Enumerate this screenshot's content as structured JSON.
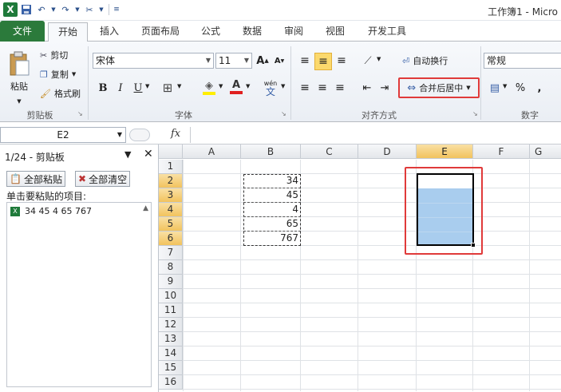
{
  "window": {
    "title": "工作簿1 - Micro"
  },
  "tabs": [
    "文件",
    "开始",
    "插入",
    "页面布局",
    "公式",
    "数据",
    "审阅",
    "视图",
    "开发工具"
  ],
  "clipboard_group": {
    "paste": "粘贴",
    "cut": "剪切",
    "copy": "复制",
    "format_painter": "格式刷",
    "label": "剪贴板"
  },
  "font_group": {
    "font_name": "宋体",
    "font_size": "11",
    "bold": "B",
    "italic": "I",
    "underline": "U",
    "phonetic": "wén",
    "label": "字体"
  },
  "align_group": {
    "wrap": "自动换行",
    "merge": "合并后居中",
    "label": "对齐方式"
  },
  "number_group": {
    "format": "常规",
    "percent": "%",
    "comma": ",",
    "label": "数字"
  },
  "formula_bar": {
    "name_box": "E2",
    "fx": "fx"
  },
  "clip_pane": {
    "title": "1/24 - 剪贴板",
    "paste_all": "全部粘贴",
    "clear_all": "全部清空",
    "hint": "单击要粘贴的项目:",
    "items": [
      "34 45 4 65 767"
    ]
  },
  "sheet": {
    "columns": [
      "A",
      "B",
      "C",
      "D",
      "E",
      "F",
      "G"
    ],
    "selected_column": "E",
    "rows": [
      "1",
      "2",
      "3",
      "4",
      "5",
      "6",
      "7",
      "8",
      "9",
      "10",
      "11",
      "12",
      "13",
      "14",
      "15",
      "16"
    ],
    "selected_rows": [
      "2",
      "3",
      "4",
      "5",
      "6"
    ],
    "b_values": [
      "34",
      "45",
      "4",
      "65",
      "767"
    ]
  },
  "colors": {
    "file_tab": "#2b7a3b",
    "highlight": "#e03a3a",
    "selection": "#a9cdee"
  }
}
